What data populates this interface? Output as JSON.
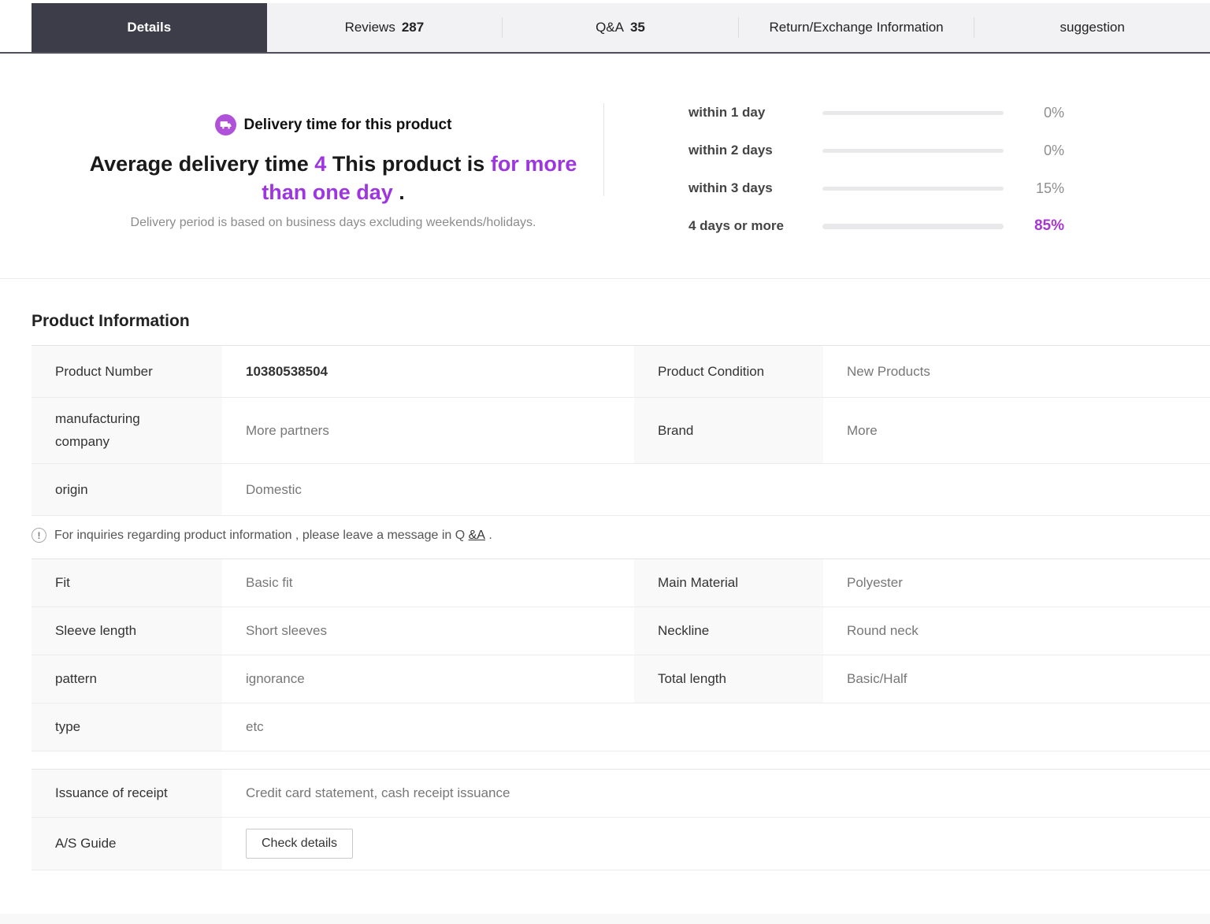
{
  "tabs": [
    {
      "label": "Details",
      "count": "",
      "active": true
    },
    {
      "label": "Reviews",
      "count": "287"
    },
    {
      "label": "Q&A",
      "count": "35"
    },
    {
      "label": "Return/Exchange Information",
      "count": ""
    },
    {
      "label": "suggestion",
      "count": ""
    }
  ],
  "delivery": {
    "title": "Delivery time for this product",
    "headline": {
      "p1": "Average delivery time ",
      "p2": "4",
      "p3": " This product is ",
      "p4": "for more than one day",
      "p5": " ."
    },
    "note": "Delivery period is based on business days excluding weekends/holidays.",
    "stats": [
      {
        "label": "within 1 day",
        "pct": 0,
        "value": "0%"
      },
      {
        "label": "within 2 days",
        "pct": 0,
        "value": "0%"
      },
      {
        "label": "within 3 days",
        "pct": 15,
        "value": "15%"
      },
      {
        "label": "4 days or more",
        "pct": 85,
        "value": "85%"
      }
    ]
  },
  "product": {
    "heading": "Product Information",
    "rows1": [
      {
        "l_label": "Product Number",
        "l_value": "10380538504",
        "r_label": "Product Condition",
        "r_value": "New Products"
      },
      {
        "l_label": "manufacturing company",
        "l_value": "More partners",
        "r_label": "Brand",
        "r_value": "More"
      },
      {
        "l_label": "origin",
        "l_value": "Domestic"
      }
    ],
    "notice": {
      "text": "For inquiries regarding product information , please leave a message in Q ",
      "link": "&A",
      "suffix": " ."
    },
    "rows2": [
      {
        "l_label": "Fit",
        "l_value": "Basic fit",
        "r_label": "Main Material",
        "r_value": "Polyester"
      },
      {
        "l_label": "Sleeve length",
        "l_value": "Short sleeves",
        "r_label": "Neckline",
        "r_value": "Round neck"
      },
      {
        "l_label": "pattern",
        "l_value": "ignorance",
        "r_label": "Total length",
        "r_value": "Basic/Half"
      },
      {
        "l_label": "type",
        "l_value": "etc"
      }
    ],
    "rows3": [
      {
        "label": "Issuance of receipt",
        "value": "Credit card statement, cash receipt issuance"
      },
      {
        "label": "A/S Guide",
        "button": "Check details"
      }
    ]
  },
  "colors": {
    "accent_text": "#9d35e0",
    "accent_bar": "#ae4cd5",
    "accent_pct": "#a637d2",
    "active_tab_bg": "#3d3d49",
    "tabbar_bg": "#f2f2f4",
    "label_cell_bg": "#f9f9fa",
    "tab_border": "#50505b"
  }
}
